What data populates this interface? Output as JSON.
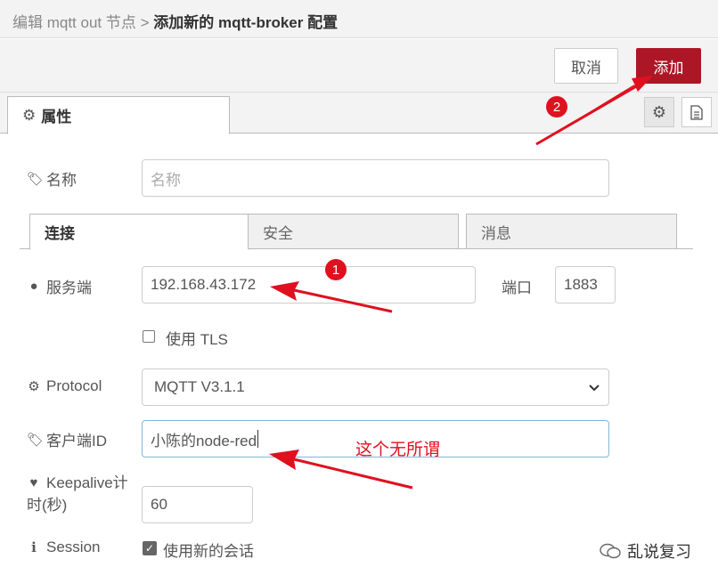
{
  "header": {
    "breadcrumb_parent": "编辑 mqtt out 节点 >",
    "breadcrumb_current": "添加新的 mqtt-broker 配置"
  },
  "toolbar": {
    "cancel_label": "取消",
    "add_label": "添加"
  },
  "tabs": {
    "properties_label": "属性"
  },
  "form": {
    "name_label": "名称",
    "name_placeholder": "名称",
    "subtabs": [
      "连接",
      "安全",
      "消息"
    ],
    "server_label": "服务端",
    "server_value": "192.168.43.172",
    "port_label": "端口",
    "port_value": "1883",
    "tls_label": "使用 TLS",
    "tls_checked": false,
    "protocol_label": "Protocol",
    "protocol_value": "MQTT V3.1.1",
    "clientid_label": "客户端ID",
    "clientid_value": "小陈的node-red",
    "keepalive_label_line1": "Keepalive计",
    "keepalive_label_line2": "时(秒)",
    "keepalive_value": "60",
    "session_label": "Session",
    "session_checkbox_label": "使用新的会话",
    "session_checked": true
  },
  "annotations": {
    "badge1": "1",
    "badge2": "2",
    "note": "这个无所谓",
    "accent_color": "#e0101f"
  },
  "watermark": {
    "text": "乱说复习"
  },
  "colors": {
    "primary_button": "#ad1625",
    "panel_bg": "#f3f3f3"
  }
}
